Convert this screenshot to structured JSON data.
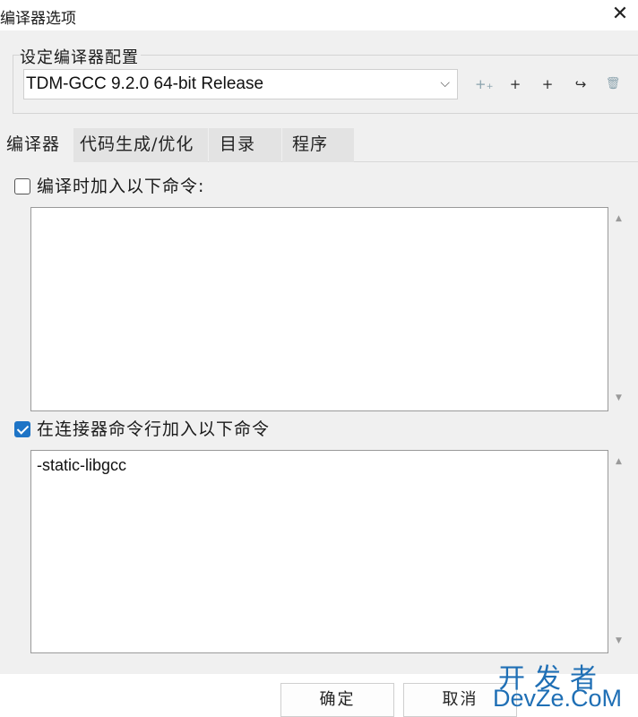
{
  "window": {
    "title": "编译器选项",
    "close_glyph": "✕"
  },
  "config": {
    "legend": "设定编译器配置",
    "selected": "TDM-GCC 9.2.0 64-bit Release",
    "chevron_glyph": "⌵",
    "toolbar": [
      {
        "icon": "add-multiple-icon",
        "glyph": "+₊"
      },
      {
        "icon": "plus-icon",
        "glyph": "+"
      },
      {
        "icon": "plus-icon",
        "glyph": "+"
      },
      {
        "icon": "redo-arrow-icon",
        "glyph": "↪"
      },
      {
        "icon": "trash-icon",
        "glyph": "🗑"
      }
    ]
  },
  "tabs": [
    {
      "label": "编译器",
      "active": true
    },
    {
      "label": "代码生成/优化",
      "active": false
    },
    {
      "label": "目录",
      "active": false
    },
    {
      "label": "程序",
      "active": false
    }
  ],
  "compile_commands": {
    "label": "编译时加入以下命令:",
    "checked": false,
    "value": ""
  },
  "linker_commands": {
    "label": "在连接器命令行加入以下命令",
    "checked": true,
    "value": "-static-libgcc"
  },
  "scroll_glyphs": {
    "up": "▲",
    "down": "▼"
  },
  "buttons": {
    "ok": "确定",
    "cancel": "取消"
  },
  "watermark": {
    "top": "开发者",
    "bottom": "DevZe.CoM"
  },
  "colors": {
    "accent": "#1e74c6",
    "watermark": "#1f6fb5"
  }
}
